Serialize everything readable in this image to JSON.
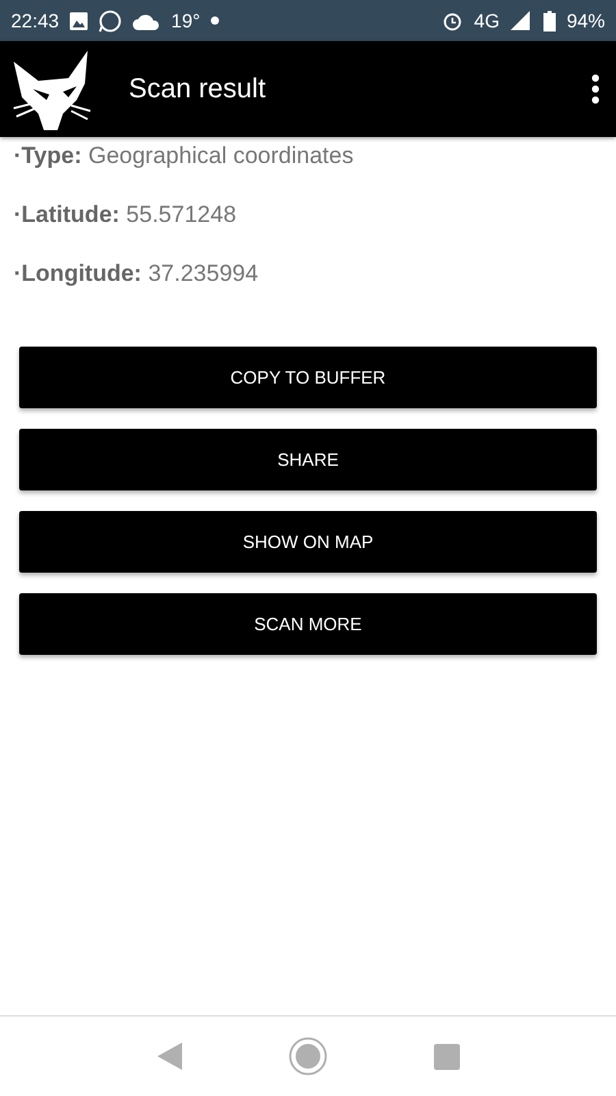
{
  "status_bar": {
    "time": "22:43",
    "temperature": "19°",
    "network": "4G",
    "battery": "94%"
  },
  "app_bar": {
    "title": "Scan result"
  },
  "fields": [
    {
      "text": "**·Type:** Geographical coordinates"
    },
    {
      "text": "**·Latitude:** 55.571248"
    },
    {
      "text": "**·Longitude:** 37.235994"
    }
  ],
  "buttons": [
    "COPY TO BUFFER",
    "SHARE",
    "SHOW ON MAP",
    "SCAN MORE"
  ]
}
